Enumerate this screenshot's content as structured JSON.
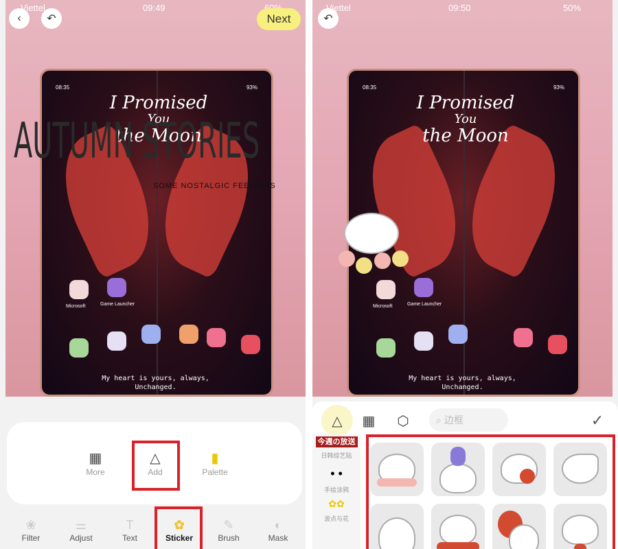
{
  "left": {
    "status": {
      "carrier": "Viettel",
      "time": "09:49",
      "battery": "60%"
    },
    "back_icon": "chevron-left-icon",
    "undo_icon": "undo-icon",
    "next_label": "Next",
    "photo": {
      "phone_time": "08:35",
      "phone_battery": "93%",
      "script_text": [
        "I Promised",
        "You",
        "the Moon"
      ],
      "overlay_title": "AUTUMN STORIES",
      "overlay_subtitle": "SOME NOSTALGIC FEELINGS",
      "apps": [
        "Microsoft",
        "Game Launcher"
      ],
      "caption": [
        "My heart is yours, always,",
        "Unchanged."
      ]
    },
    "sticker_options": [
      {
        "label": "More",
        "icon": "store-icon"
      },
      {
        "label": "Add",
        "icon": "add-shape-icon"
      },
      {
        "label": "Palette",
        "icon": "palette-icon"
      }
    ],
    "toolbar": [
      {
        "label": "Filter",
        "icon": "filter-icon"
      },
      {
        "label": "Adjust",
        "icon": "sliders-icon"
      },
      {
        "label": "Text",
        "icon": "text-icon"
      },
      {
        "label": "Sticker",
        "icon": "sticker-icon",
        "active": true
      },
      {
        "label": "Brush",
        "icon": "brush-icon"
      },
      {
        "label": "Mask",
        "icon": "mask-icon"
      }
    ],
    "highlight_color": "#d8212a"
  },
  "right": {
    "status": {
      "carrier": "Viettel",
      "time": "09:50",
      "battery": "50%"
    },
    "undo_icon": "undo-icon",
    "photo": {
      "phone_time": "08:35",
      "phone_battery": "93%",
      "script_text": [
        "I Promised",
        "You",
        "the Moon"
      ],
      "apps": [
        "Microsoft",
        "Game Launcher"
      ],
      "caption": [
        "My heart is yours, always,",
        "Unchanged."
      ]
    },
    "sheet": {
      "search_placeholder": "边框",
      "categories": [
        "今週の放送",
        "日韩综艺贴",
        "手绘涂鸦",
        "波点与花"
      ],
      "confirm_icon": "checkmark-icon",
      "sticker_count_visible": 8
    }
  }
}
